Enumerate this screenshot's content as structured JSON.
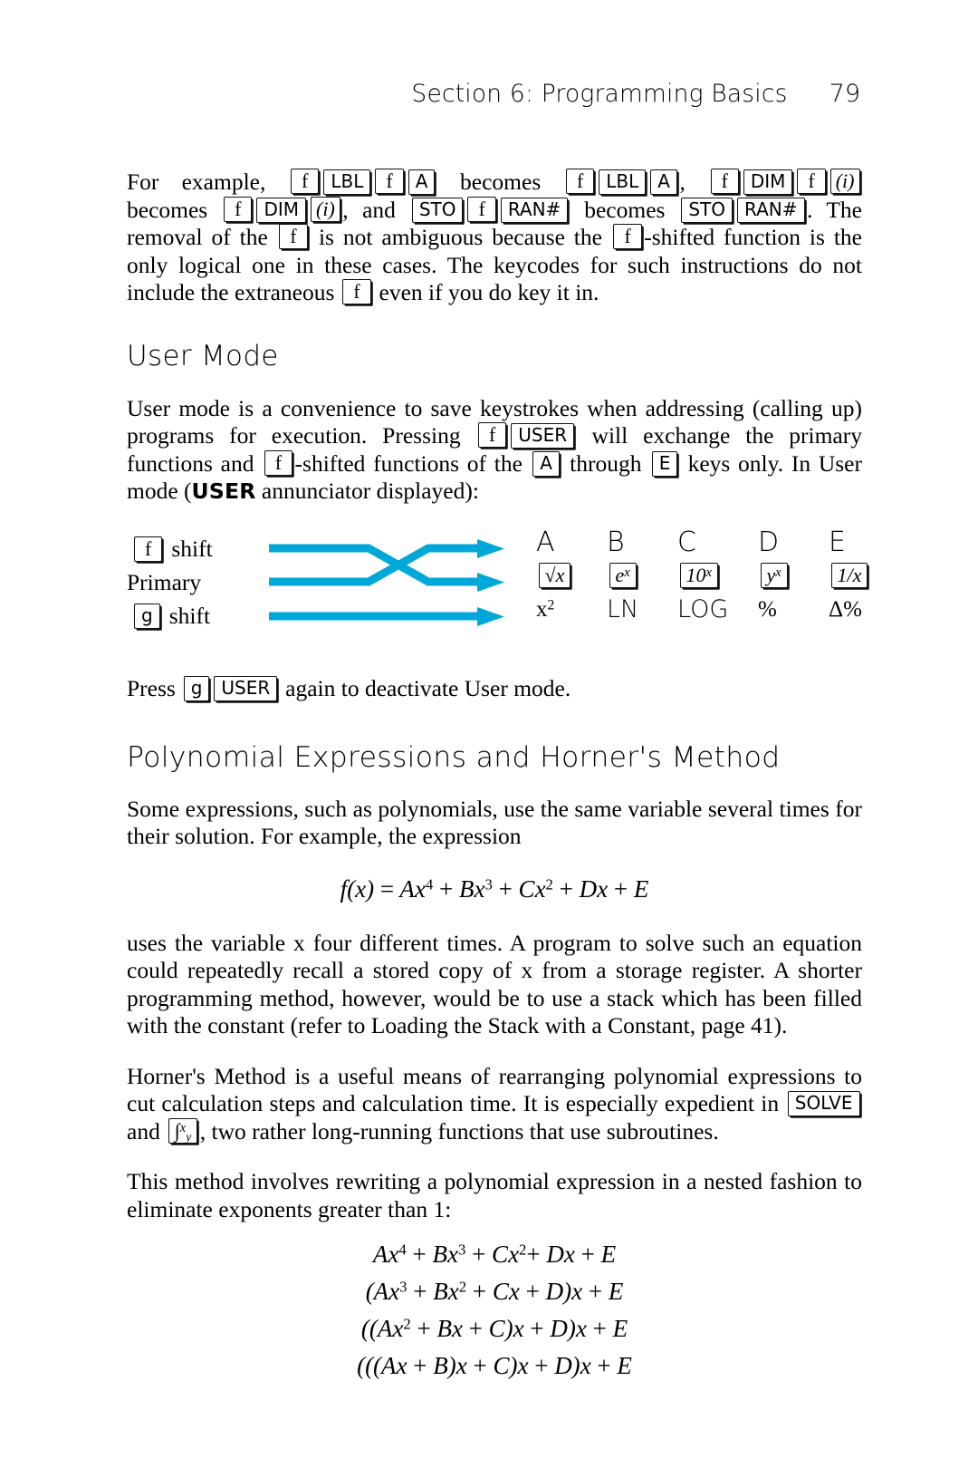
{
  "header": {
    "title": "Section 6: Programming Basics",
    "page_number": "79"
  },
  "intro_paragraph": {
    "t1": "For example, ",
    "k1": "f",
    "k2": "LBL",
    "k3": "f",
    "k4": "A",
    "t2": " becomes ",
    "k5": "f",
    "k6": "LBL",
    "k7": "A",
    "t3": ", ",
    "k8": "f",
    "k9": "DIM",
    "k10": "f",
    "k11": "(i)",
    "t4": " becomes ",
    "k12": "f",
    "k13": "DIM",
    "k14": "(i)",
    "t5": ", and ",
    "k15": "STO",
    "k16": "f",
    "k17": "RAN#",
    "t6": " becomes ",
    "k18": "STO",
    "k19": "RAN#",
    "t7": ". The removal of the ",
    "k20": "f",
    "t8": " is not ambiguous because the ",
    "k21": "f",
    "t9": "-shifted function is the only logical one in these cases. The keycodes for such instructions do not include the extraneous ",
    "k22": "f",
    "t10": " even if you do key it in."
  },
  "user_mode": {
    "heading": "User Mode",
    "p1_t1": "User mode is a convenience to save keystrokes when addressing (calling up) programs for execution. Pressing ",
    "p1_k1": "f",
    "p1_k2": "USER",
    "p1_t2": " will exchange the primary functions and ",
    "p1_k3": "f",
    "p1_t3": "-shifted functions of the ",
    "p1_k4": "A",
    "p1_t4": " through ",
    "p1_k5": "E",
    "p1_t5": " keys only. In User mode (",
    "p1_annunciator": "USER",
    "p1_t6": " annunciator displayed):",
    "diagram": {
      "row_labels": [
        {
          "key": "f",
          "text": "shift"
        },
        {
          "key": null,
          "text": "Primary"
        },
        {
          "key": "g",
          "text": "shift"
        }
      ],
      "columns": [
        {
          "letter": "A",
          "primary": "√x",
          "gshift": "x²"
        },
        {
          "letter": "B",
          "primary": "e^x",
          "gshift": "LN"
        },
        {
          "letter": "C",
          "primary": "10^x",
          "gshift": "LOG"
        },
        {
          "letter": "D",
          "primary": "y^x",
          "gshift": "%"
        },
        {
          "letter": "E",
          "primary": "1/x",
          "gshift": "Δ%"
        }
      ],
      "arrow_color": "#00a8d8"
    },
    "p2_t1": "Press ",
    "p2_k1": "g",
    "p2_k2": "USER",
    "p2_t2": " again to deactivate User mode."
  },
  "horner": {
    "heading": "Polynomial Expressions and Horner's Method",
    "p1": "Some expressions, such as polynomials, use the same variable several times for their solution. For example, the expression",
    "formula_main": "f(x) = Ax⁴ + Bx³ + Cx² + Dx + E",
    "p2": "uses the variable x four different times. A program to solve such an equation could repeatedly recall a stored copy of x from a storage register. A shorter programming method, however, would be to use a stack which has been filled with the constant (refer to Loading the Stack with a Constant, page 41).",
    "p3_t1": "Horner's Method is a useful means of rearranging polynomial expressions to cut calculation steps and calculation time. It is especially expedient in ",
    "p3_k1": "SOLVE",
    "p3_t2": " and ",
    "p3_k2": "∫ y x",
    "p3_t3": ", two rather long-running functions that use subroutines.",
    "p4": "This method involves rewriting a polynomial expression in a nested fashion to eliminate exponents greater than 1:",
    "nested_lines": [
      "Ax⁴ + Bx³ + Cx² + Dx + E",
      "(Ax³ + Bx² + Cx + D)x + E",
      "((Ax² + Bx + C)x + D)x + E",
      "(((Ax + B)x + C)x + D)x + E"
    ]
  }
}
